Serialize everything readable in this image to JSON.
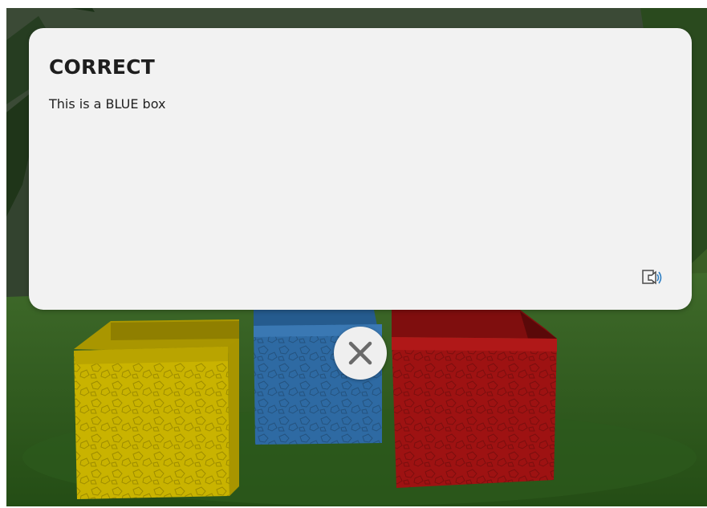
{
  "feedback": {
    "title": "CORRECT",
    "message": "This is a BLUE box"
  },
  "controls": {
    "audio_icon": "audio-speaker-icon",
    "close_icon": "close-x-icon"
  },
  "scene": {
    "boxes": [
      {
        "color_name": "yellow",
        "color": "#c9b300"
      },
      {
        "color_name": "blue",
        "color": "#2e6aa3"
      },
      {
        "color_name": "red",
        "color": "#9e1212"
      }
    ],
    "ground_color": "#2f5a1f",
    "foliage_color": "#2d4a22"
  },
  "colors": {
    "dialog_background": "#f2f2f2",
    "title_text": "#1e1e1e",
    "body_text": "#222222",
    "close_icon_color": "#6a6a6a"
  }
}
